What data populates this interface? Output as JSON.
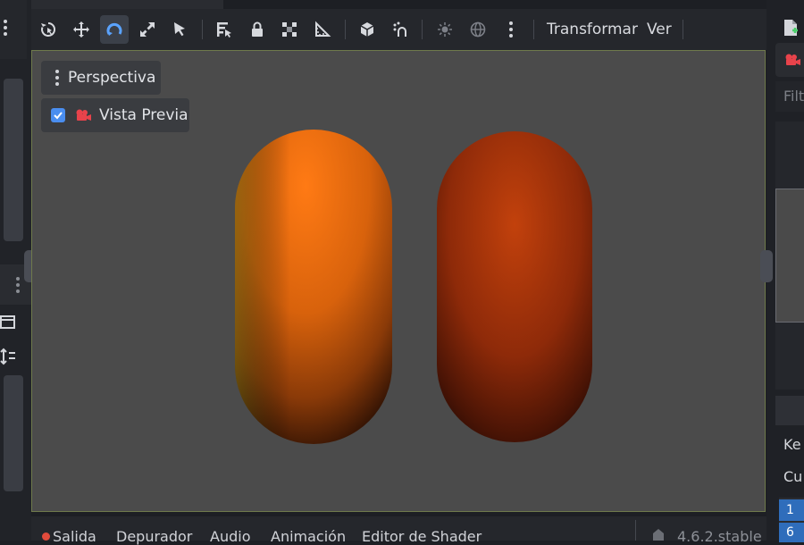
{
  "toolbar": {
    "tools": [
      {
        "name": "select-mode",
        "icon": "select-rotate-icon"
      },
      {
        "name": "move-mode",
        "icon": "move-icon"
      },
      {
        "name": "rotate-mode",
        "icon": "rotate-icon",
        "active": true
      },
      {
        "name": "scale-mode",
        "icon": "scale-icon"
      },
      {
        "name": "list-select",
        "icon": "cursor-icon"
      },
      {
        "name": "ruler-list",
        "icon": "list-select-icon"
      },
      {
        "name": "lock",
        "icon": "lock-icon"
      },
      {
        "name": "group",
        "icon": "group-icon"
      },
      {
        "name": "ruler",
        "icon": "ruler-icon"
      },
      {
        "name": "local-space",
        "icon": "cube-icon"
      },
      {
        "name": "snap",
        "icon": "snap-icon"
      },
      {
        "name": "sun",
        "icon": "sun-icon"
      },
      {
        "name": "environment",
        "icon": "globe-icon"
      },
      {
        "name": "more",
        "icon": "kebab-icon"
      }
    ],
    "menus": [
      "Transformar",
      "Ver"
    ]
  },
  "viewport": {
    "perspective_label": "Perspectiva",
    "preview_label": "Vista Previa",
    "preview_checked": true
  },
  "right_dock": {
    "filter_placeholder": "Filt",
    "row_1": "Ke",
    "row_2": "Cu",
    "num_1": "1",
    "num_2": "6"
  },
  "bottom_panel": {
    "tabs": [
      "Salida",
      "Depurador",
      "Audio",
      "Animación",
      "Editor de Shader"
    ],
    "version": "4.6.2.stable"
  },
  "colors": {
    "accent": "#4a8ef0",
    "viewport_bg": "#4b4b4b",
    "viewport_border": "#6f7a4c",
    "preview_camera": "#e8434b",
    "output_dot": "#e14b3c"
  }
}
